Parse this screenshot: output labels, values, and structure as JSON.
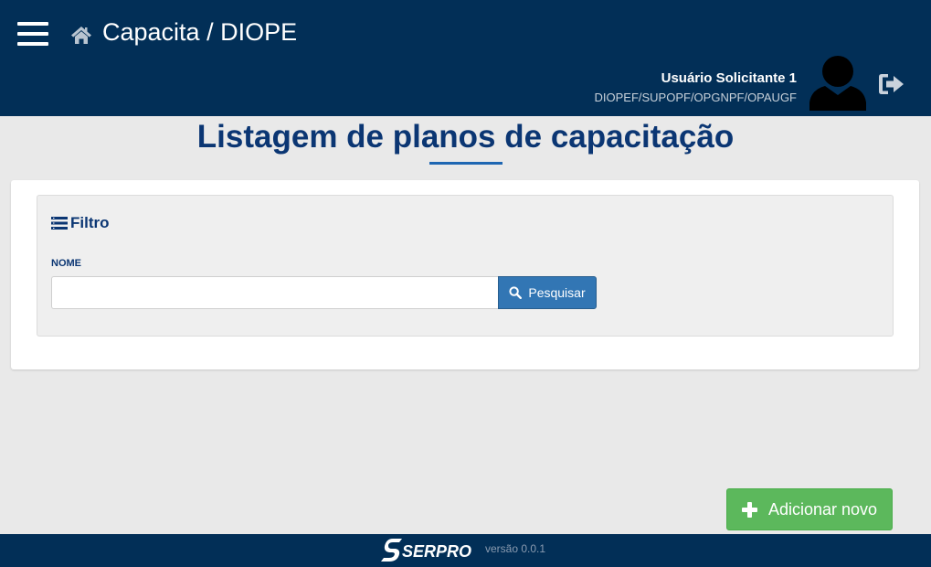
{
  "header": {
    "app_title": "Capacita / DIOPE",
    "user_name": "Usuário Solicitante 1",
    "user_org": "DIOPEF/SUPOPF/OPGNPF/OPAUGF",
    "icons": [
      "menu-icon",
      "home-icon",
      "user-avatar-icon",
      "logout-icon"
    ]
  },
  "page": {
    "title": "Listagem de planos de capacitação"
  },
  "filter": {
    "title": "Filtro",
    "icon": "filter-list-icon",
    "name_label": "NOME",
    "name_value": "",
    "search_label": "Pesquisar",
    "search_icon": "search-icon"
  },
  "actions": {
    "add_label": "Adicionar novo",
    "add_icon": "plus-icon"
  },
  "footer": {
    "brand": "SERPRO",
    "version": "versão 0.0.1"
  },
  "colors": {
    "header_bg": "#022f57",
    "title_color": "#0b3673",
    "primary_button": "#3276b4",
    "success_button": "#5cb85c",
    "page_bg": "#e9e9e9"
  }
}
